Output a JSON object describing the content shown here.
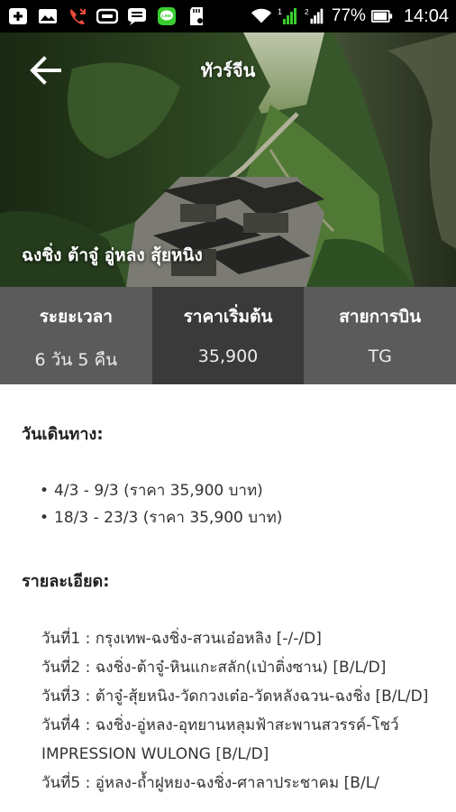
{
  "status_bar": {
    "battery_percent": "77%",
    "time": "14:04",
    "icons": [
      "plus-box-icon",
      "gallery-icon",
      "missed-call-icon",
      "voicemail-icon",
      "message-icon",
      "line-app-icon",
      "sd-card-icon",
      "wifi-icon",
      "signal-1-icon",
      "signal-2-icon",
      "battery-icon"
    ]
  },
  "hero": {
    "title": "ทัวร์จีน",
    "subtitle": "ฉงชิ่ง ต้าจู๋ อู่หลง สุ้ยหนิง"
  },
  "info": {
    "duration_label": "ระยะเวลา",
    "duration_value": "6 วัน 5 คืน",
    "price_label": "ราคาเริ่มต้น",
    "price_value": "35,900",
    "airline_label": "สายการบิน",
    "airline_value": "TG"
  },
  "travel_dates": {
    "title": "วันเดินทาง:",
    "items": [
      "4/3 - 9/3 (ราคา 35,900 บาท)",
      "18/3 - 23/3 (ราคา 35,900 บาท)"
    ]
  },
  "details": {
    "title": "รายละเอียด:",
    "days": [
      "วันที่1 : กรุงเทพ-ฉงชิ่ง-สวนเอ๋อหลิง [-/-/D]",
      "วันที่2 : ฉงชิ่ง-ต้าจู๋-หินแกะสลัก(เป่าติ่งซาน) [B/L/D]",
      "วันที่3 : ต้าจู๋-สุ้ยหนิง-วัดกวงเต๋อ-วัดหลังฉวน-ฉงชิ่ง [B/L/D]",
      "วันที่4 : ฉงชิ่ง-อู่หลง-อุทยานหลุมฟ้าสะพานสวรรค์-โชว์ IMPRESSION WULONG [B/L/D]",
      "วันที่5 : อู่หลง-ถ้ำฝูหยง-ฉงชิ่ง-ศาลาประชาคม [B/L/"
    ]
  }
}
